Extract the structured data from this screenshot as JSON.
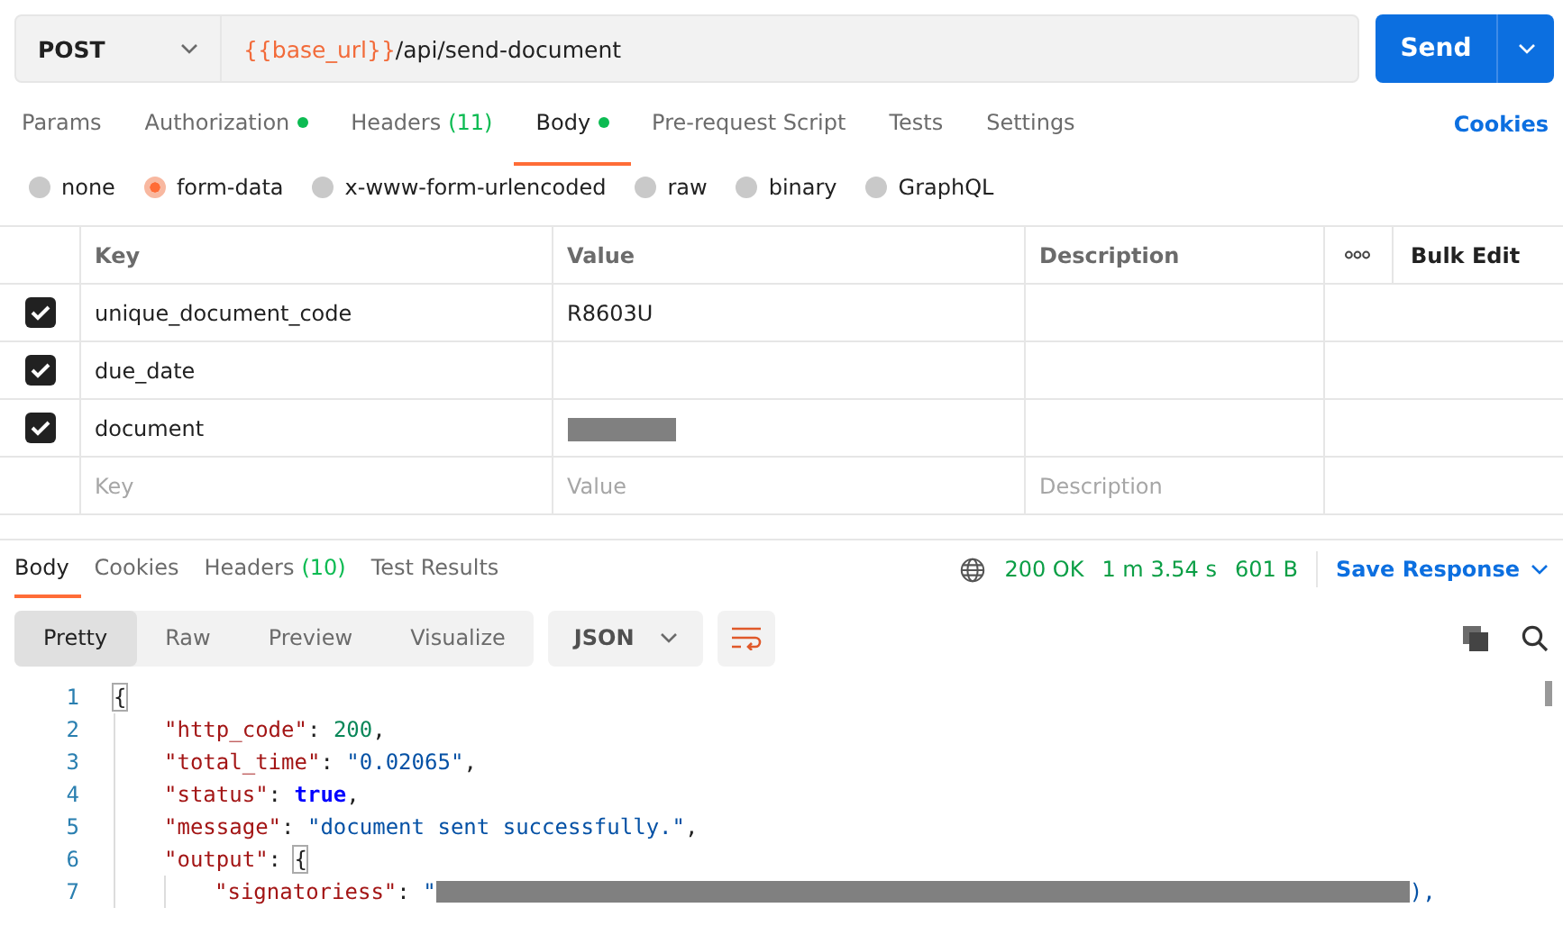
{
  "request": {
    "method": "POST",
    "url_variable": "{{base_url}}",
    "url_path": "/api/send-document",
    "send_label": "Send"
  },
  "request_tabs": [
    {
      "label": "Params",
      "selected": false
    },
    {
      "label": "Authorization",
      "selected": false,
      "dot": true
    },
    {
      "label": "Headers",
      "count": "(11)",
      "selected": false
    },
    {
      "label": "Body",
      "selected": true,
      "dot": true
    },
    {
      "label": "Pre-request Script",
      "selected": false
    },
    {
      "label": "Tests",
      "selected": false
    },
    {
      "label": "Settings",
      "selected": false
    }
  ],
  "cookies_link": "Cookies",
  "body_types": [
    {
      "label": "none",
      "selected": false
    },
    {
      "label": "form-data",
      "selected": true
    },
    {
      "label": "x-www-form-urlencoded",
      "selected": false
    },
    {
      "label": "raw",
      "selected": false
    },
    {
      "label": "binary",
      "selected": false
    },
    {
      "label": "GraphQL",
      "selected": false
    }
  ],
  "params_table": {
    "columns": [
      "Key",
      "Value",
      "Description"
    ],
    "bulk_edit": "Bulk Edit",
    "rows": [
      {
        "checked": true,
        "key": "unique_document_code",
        "value": "R8603U",
        "redacted": false
      },
      {
        "checked": true,
        "key": "due_date",
        "redacted": false
      },
      {
        "checked": true,
        "key": "document",
        "redacted": true
      }
    ],
    "placeholders": {
      "key": "Key",
      "value": "Value",
      "description": "Description"
    }
  },
  "response_tabs": [
    {
      "label": "Body",
      "selected": true
    },
    {
      "label": "Cookies",
      "selected": false
    },
    {
      "label": "Headers",
      "count": "(10)",
      "selected": false
    },
    {
      "label": "Test Results",
      "selected": false
    }
  ],
  "response_meta": {
    "status": "200 OK",
    "time": "1 m 3.54 s",
    "size": "601 B",
    "save_label": "Save Response"
  },
  "view_modes": [
    {
      "label": "Pretty",
      "selected": true
    },
    {
      "label": "Raw",
      "selected": false
    },
    {
      "label": "Preview",
      "selected": false
    },
    {
      "label": "Visualize",
      "selected": false
    }
  ],
  "format": "JSON",
  "code_lines": [
    {
      "number": "1",
      "tokens": [
        {
          "kind": "brace",
          "text": "{"
        }
      ],
      "children": [
        {
          "number": "2",
          "tokens": [
            {
              "kind": "key",
              "text": "\"http_code\""
            },
            {
              "kind": "punct",
              "text": ": "
            },
            {
              "kind": "number",
              "text": "200"
            },
            {
              "kind": "punct",
              "text": ","
            }
          ]
        },
        {
          "number": "3",
          "tokens": [
            {
              "kind": "key",
              "text": "\"total_time\""
            },
            {
              "kind": "punct",
              "text": ": "
            },
            {
              "kind": "string",
              "text": "\"0.02065\""
            },
            {
              "kind": "punct",
              "text": ","
            }
          ]
        },
        {
          "number": "4",
          "tokens": [
            {
              "kind": "key",
              "text": "\"status\""
            },
            {
              "kind": "punct",
              "text": ": "
            },
            {
              "kind": "bool",
              "text": "true"
            },
            {
              "kind": "punct",
              "text": ","
            }
          ]
        },
        {
          "number": "5",
          "tokens": [
            {
              "kind": "key",
              "text": "\"message\""
            },
            {
              "kind": "punct",
              "text": ": "
            },
            {
              "kind": "string",
              "text": "\"document sent successfully.\""
            },
            {
              "kind": "punct",
              "text": ","
            }
          ]
        },
        {
          "number": "6",
          "tokens": [
            {
              "kind": "key",
              "text": "\"output\""
            },
            {
              "kind": "punct",
              "text": ": "
            },
            {
              "kind": "brace",
              "text": "{"
            }
          ],
          "children": [
            {
              "number": "7",
              "tokens": [
                {
                  "kind": "key",
                  "text": "\"signatoriess\""
                },
                {
                  "kind": "punct",
                  "text": ": "
                },
                {
                  "kind": "string",
                  "text": "\""
                },
                {
                  "kind": "redacted"
                },
                {
                  "kind": "string",
                  "text": "),"
                }
              ]
            }
          ]
        }
      ]
    }
  ]
}
